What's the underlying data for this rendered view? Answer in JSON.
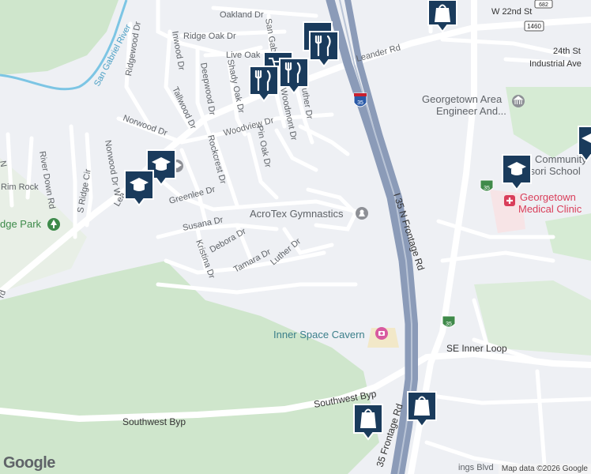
{
  "streets": {
    "oakland": "Oakland Dr",
    "ridge_oak": "Ridge Oak Dr",
    "live_oak": "Live Oak Dr",
    "san_gabriel": "San Gabri...",
    "ridgewood": "Ridgewood Dr",
    "inwood": "Inwood Dr",
    "deepwood": "Deepwood Dr",
    "shady_oak": "Shady Oak Dr",
    "tallwood": "Tallwood Dr",
    "norwood": "Norwood Dr",
    "woodview": "Woodview Dr",
    "woodmont": "Woodmont Dr",
    "luther_n": "uther Dr",
    "pin_oak": "Pin Oak Dr",
    "rockcrest": "Rockcrest Dr",
    "greenlee": "Greenlee Dr",
    "river_down": "River Down Rd",
    "norwood_w": "Norwood Dr W",
    "s_ridge": "S Ridge Cir",
    "rim_rock": "Rim Rock",
    "leander_w": "Lea",
    "leander_e": "Leander Rd",
    "susana": "Susana Dr",
    "debora": "Debora Dr",
    "tamara": "Tamara Dr",
    "luther_s": "Luther Dr",
    "kristina": "Kristina Dr",
    "frontage_n": "I 35 N Frontage Rd",
    "frontage_s": "35 Frontage Rd",
    "se_inner_loop": "SE Inner Loop",
    "sw_byp_center": "Southwest Byp",
    "sw_byp_left": "Southwest Byp",
    "w_22nd": "W 22nd St",
    "st_24th": "24th St",
    "industrial": "Industrial Ave",
    "ings_blvd": "ings Blvd",
    "rd_left": "rd",
    "n_tip": "N"
  },
  "water": {
    "san_gabriel_river": "San Gabriel River"
  },
  "shields": {
    "i35_north": "35",
    "i35_east": "35",
    "i35_south": "35",
    "rm_1460": "1460",
    "f_682": "682"
  },
  "places": {
    "acrotex": "AcroTex Gymnastics",
    "inner_space": "Inner Space Cavern",
    "georgetown_engineer_l1": "Georgetown Area",
    "georgetown_engineer_l2": "Engineer And...",
    "medical_l1": "Georgetown",
    "medical_l2": "Medical Clinic",
    "community_l1": "Community",
    "community_l2": "M    sori School",
    "park": "dge Park"
  },
  "footer": {
    "logo": "Google",
    "attribution": "Map data ©2026 Google"
  },
  "colors": {
    "highway": "#8b9bb8",
    "marker": "#1a3b5c",
    "park": "#cfe6cc",
    "poi_teal": "#3b7f8a",
    "poi_pink": "#d93e5a",
    "water": "#7cc5e4"
  },
  "icons": {
    "restaurant": "fork-knife-icon",
    "shopping": "shopping-bag-icon",
    "school": "graduation-cap-icon",
    "hospital": "hospital-cross-icon",
    "park": "tree-icon",
    "attraction": "camera-icon"
  }
}
